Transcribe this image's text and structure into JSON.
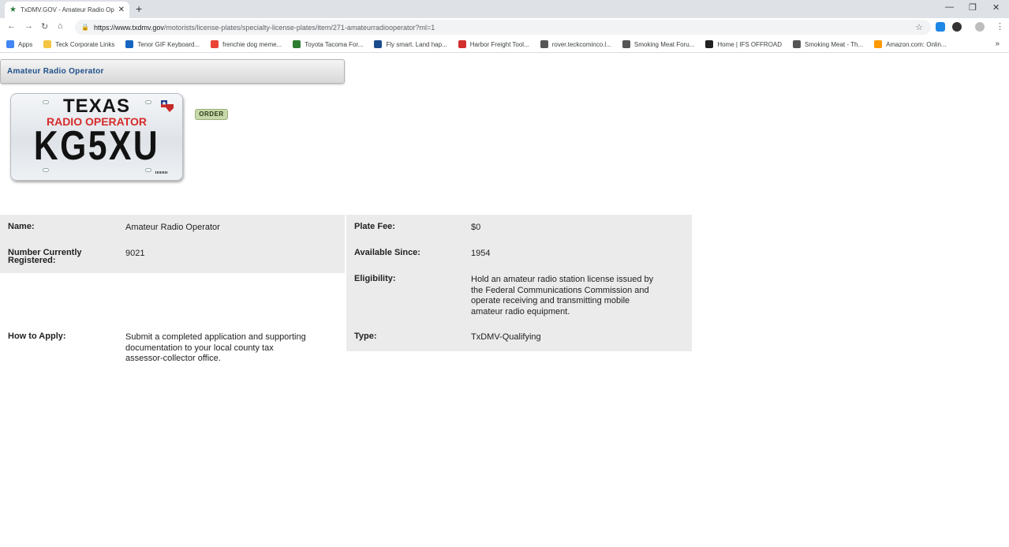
{
  "browser": {
    "tab_title": "TxDMV.GOV - Amateur Radio Op",
    "url_prefix": "https://www.txdmv.gov",
    "url_path": "/motorists/license-plates/specialty-license-plates/item/271-amateurradiooperator?ml=1",
    "bookmarks": [
      {
        "label": "Apps",
        "icon": "apps-grid-icon",
        "color": "#4285f4"
      },
      {
        "label": "Teck Corporate Links",
        "icon": "folder-icon",
        "color": "#f4c542"
      },
      {
        "label": "Tenor GIF Keyboard...",
        "icon": "gif-icon",
        "color": "#1565c0"
      },
      {
        "label": "frenchie dog meme...",
        "icon": "google-icon",
        "color": "#ea4335"
      },
      {
        "label": "Toyota Tacoma For...",
        "icon": "forum-icon",
        "color": "#2e7d32"
      },
      {
        "label": "Fly smart. Land hap...",
        "icon": "globe-icon",
        "color": "#1a4b8c"
      },
      {
        "label": "Harbor Freight Tool...",
        "icon": "hft-icon",
        "color": "#d32f2f"
      },
      {
        "label": "rover.teckcominco.l...",
        "icon": "globe-icon",
        "color": "#555555"
      },
      {
        "label": "Smoking Meat Foru...",
        "icon": "smoking-meat-icon",
        "color": "#555555"
      },
      {
        "label": "Home | IFS OFFROAD",
        "icon": "ifs-icon",
        "color": "#222222"
      },
      {
        "label": "Smoking Meat - Th...",
        "icon": "smoking-meat-icon",
        "color": "#555555"
      },
      {
        "label": "Amazon.com: Onlin...",
        "icon": "amazon-icon",
        "color": "#ff9900"
      }
    ]
  },
  "page": {
    "heading": "Amateur Radio Operator",
    "plate": {
      "state": "TEXAS",
      "subtitle": "RADIO OPERATOR",
      "number": "KG5XU"
    },
    "order_button": "ORDER",
    "details": {
      "name_label": "Name:",
      "name_value": "Amateur Radio Operator",
      "registered_label": "Number Currently Registered:",
      "registered_value": "9021",
      "apply_label": "How to Apply:",
      "apply_value": "Submit a completed application and supporting documentation to your local county tax assessor-collector office.",
      "fee_label": "Plate Fee:",
      "fee_value": "$0",
      "since_label": "Available Since:",
      "since_value": "1954",
      "eligibility_label": "Eligibility:",
      "eligibility_value": "Hold an amateur radio station license issued by the Federal Communications Commission and operate receiving and transmitting mobile amateur radio equipment.",
      "type_label": "Type:",
      "type_value": "TxDMV-Qualifying"
    }
  }
}
